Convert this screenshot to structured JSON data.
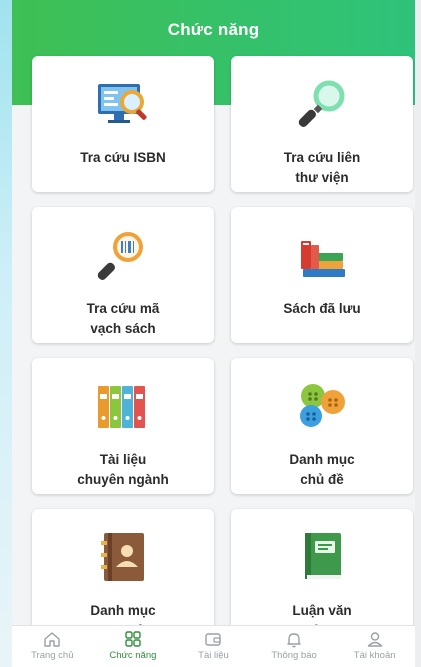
{
  "header": {
    "title": "Chức năng"
  },
  "cards": [
    {
      "label": "Tra cứu ISBN",
      "icon": "monitor-search-icon"
    },
    {
      "label": "Tra cứu liên\nthư viện",
      "icon": "magnifier-icon"
    },
    {
      "label": "Tra cứu mã\nvạch sách",
      "icon": "barcode-search-icon"
    },
    {
      "label": "Sách đã lưu",
      "icon": "book-stack-icon"
    },
    {
      "label": "Tài liệu\nchuyên ngành",
      "icon": "binders-icon"
    },
    {
      "label": "Danh mục\nchủ đề",
      "icon": "buttons-icon"
    },
    {
      "label": "Danh mục\ntác giả",
      "icon": "contact-book-icon"
    },
    {
      "label": "Luận văn\nLuận án",
      "icon": "green-book-icon"
    }
  ],
  "tabbar": [
    {
      "label": "Trang chủ",
      "icon": "home-icon",
      "active": false
    },
    {
      "label": "Chức năng",
      "icon": "grid-icon",
      "active": true
    },
    {
      "label": "Tài liệu",
      "icon": "wallet-icon",
      "active": false
    },
    {
      "label": "Thông báo",
      "icon": "bell-icon",
      "active": false
    },
    {
      "label": "Tài khoản",
      "icon": "user-icon",
      "active": false
    }
  ],
  "colors": {
    "header": "#3cc063",
    "active_tab": "#2f8f3a",
    "inactive_tab": "#9aa0a6"
  }
}
